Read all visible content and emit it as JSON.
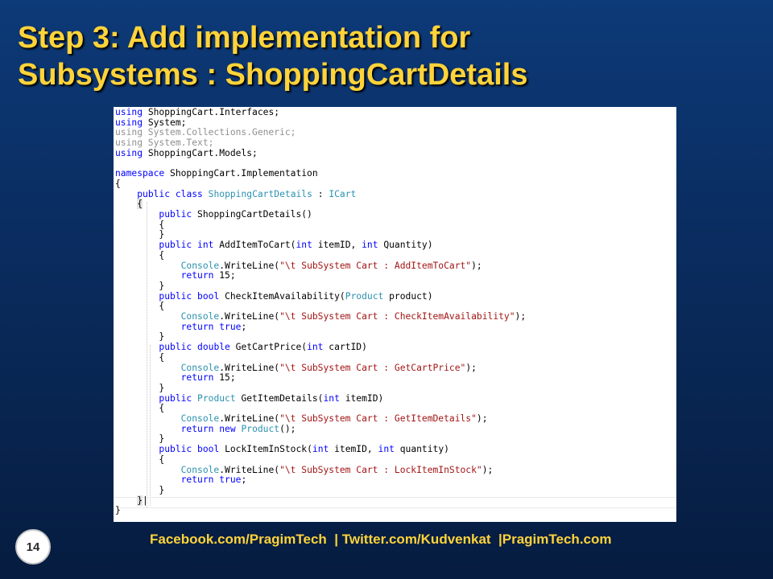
{
  "slide": {
    "title_line1": "Step 3:  Add implementation for",
    "title_line2": "Subsystems : ShoppingCartDetails",
    "page_number": "14",
    "footer": "Facebook.com/PragimTech  | Twitter.com/Kudvenkat  |PragimTech.com"
  },
  "colors": {
    "title": "#ffd33a",
    "keyword": "#0000ff",
    "type": "#2b91af",
    "string": "#a31515",
    "unused_using": "#8f8f8f"
  },
  "code": {
    "lines": [
      [
        {
          "t": "using",
          "c": "kw"
        },
        {
          "t": " ShoppingCart.Interfaces;"
        }
      ],
      [
        {
          "t": "using",
          "c": "kw"
        },
        {
          "t": " System;"
        }
      ],
      [
        {
          "t": "using System.Collections.Generic;",
          "c": "dim"
        }
      ],
      [
        {
          "t": "using System.Text;",
          "c": "dim"
        }
      ],
      [
        {
          "t": "using",
          "c": "kw"
        },
        {
          "t": " ShoppingCart.Models;"
        }
      ],
      [],
      [
        {
          "t": "namespace",
          "c": "kw"
        },
        {
          "t": " ShoppingCart.Implementation"
        }
      ],
      [
        {
          "t": "{"
        }
      ],
      [
        {
          "t": "    "
        },
        {
          "t": "public",
          "c": "kw"
        },
        {
          "t": " "
        },
        {
          "t": "class",
          "c": "kw"
        },
        {
          "t": " "
        },
        {
          "t": "ShoppingCartDetails",
          "c": "ty"
        },
        {
          "t": " : "
        },
        {
          "t": "ICart",
          "c": "ty"
        }
      ],
      [
        {
          "t": "    "
        },
        {
          "t": "{",
          "c": "hl"
        }
      ],
      [
        {
          "t": "        "
        },
        {
          "t": "public",
          "c": "kw"
        },
        {
          "t": " ShoppingCartDetails()"
        }
      ],
      [
        {
          "t": "        {"
        }
      ],
      [
        {
          "t": "        }"
        }
      ],
      [
        {
          "t": "        "
        },
        {
          "t": "public",
          "c": "kw"
        },
        {
          "t": " "
        },
        {
          "t": "int",
          "c": "kw"
        },
        {
          "t": " AddItemToCart("
        },
        {
          "t": "int",
          "c": "kw"
        },
        {
          "t": " itemID, "
        },
        {
          "t": "int",
          "c": "kw"
        },
        {
          "t": " Quantity)"
        }
      ],
      [
        {
          "t": "        {"
        }
      ],
      [
        {
          "t": "            "
        },
        {
          "t": "Console",
          "c": "ty"
        },
        {
          "t": ".WriteLine("
        },
        {
          "t": "\"\\t SubSystem Cart : AddItemToCart\"",
          "c": "st"
        },
        {
          "t": ");"
        }
      ],
      [
        {
          "t": "            "
        },
        {
          "t": "return",
          "c": "kw"
        },
        {
          "t": " 15;"
        }
      ],
      [
        {
          "t": "        }"
        }
      ],
      [
        {
          "t": "        "
        },
        {
          "t": "public",
          "c": "kw"
        },
        {
          "t": " "
        },
        {
          "t": "bool",
          "c": "kw"
        },
        {
          "t": " CheckItemAvailability("
        },
        {
          "t": "Product",
          "c": "ty"
        },
        {
          "t": " product)"
        }
      ],
      [
        {
          "t": "        {"
        }
      ],
      [
        {
          "t": "            "
        },
        {
          "t": "Console",
          "c": "ty"
        },
        {
          "t": ".WriteLine("
        },
        {
          "t": "\"\\t SubSystem Cart : CheckItemAvailability\"",
          "c": "st"
        },
        {
          "t": ");"
        }
      ],
      [
        {
          "t": "            "
        },
        {
          "t": "return",
          "c": "kw"
        },
        {
          "t": " "
        },
        {
          "t": "true",
          "c": "kw"
        },
        {
          "t": ";"
        }
      ],
      [
        {
          "t": "        }"
        }
      ],
      [
        {
          "t": "        "
        },
        {
          "t": "public",
          "c": "kw"
        },
        {
          "t": " "
        },
        {
          "t": "double",
          "c": "kw"
        },
        {
          "t": " GetCartPrice("
        },
        {
          "t": "int",
          "c": "kw"
        },
        {
          "t": " cartID)"
        }
      ],
      [
        {
          "t": "        {"
        }
      ],
      [
        {
          "t": "            "
        },
        {
          "t": "Console",
          "c": "ty"
        },
        {
          "t": ".WriteLine("
        },
        {
          "t": "\"\\t SubSystem Cart : GetCartPrice\"",
          "c": "st"
        },
        {
          "t": ");"
        }
      ],
      [
        {
          "t": "            "
        },
        {
          "t": "return",
          "c": "kw"
        },
        {
          "t": " 15;"
        }
      ],
      [
        {
          "t": "        }"
        }
      ],
      [
        {
          "t": "        "
        },
        {
          "t": "public",
          "c": "kw"
        },
        {
          "t": " "
        },
        {
          "t": "Product",
          "c": "ty"
        },
        {
          "t": " GetItemDetails("
        },
        {
          "t": "int",
          "c": "kw"
        },
        {
          "t": " itemID)"
        }
      ],
      [
        {
          "t": "        {"
        }
      ],
      [
        {
          "t": "            "
        },
        {
          "t": "Console",
          "c": "ty"
        },
        {
          "t": ".WriteLine("
        },
        {
          "t": "\"\\t SubSystem Cart : GetItemDetails\"",
          "c": "st"
        },
        {
          "t": ");"
        }
      ],
      [
        {
          "t": "            "
        },
        {
          "t": "return",
          "c": "kw"
        },
        {
          "t": " "
        },
        {
          "t": "new",
          "c": "kw"
        },
        {
          "t": " "
        },
        {
          "t": "Product",
          "c": "ty"
        },
        {
          "t": "();"
        }
      ],
      [
        {
          "t": "        }"
        }
      ],
      [
        {
          "t": "        "
        },
        {
          "t": "public",
          "c": "kw"
        },
        {
          "t": " "
        },
        {
          "t": "bool",
          "c": "kw"
        },
        {
          "t": " LockItemInStock("
        },
        {
          "t": "int",
          "c": "kw"
        },
        {
          "t": " itemID, "
        },
        {
          "t": "int",
          "c": "kw"
        },
        {
          "t": " quantity)"
        }
      ],
      [
        {
          "t": "        {"
        }
      ],
      [
        {
          "t": "            "
        },
        {
          "t": "Console",
          "c": "ty"
        },
        {
          "t": ".WriteLine("
        },
        {
          "t": "\"\\t SubSystem Cart : LockItemInStock\"",
          "c": "st"
        },
        {
          "t": ");"
        }
      ],
      [
        {
          "t": "            "
        },
        {
          "t": "return",
          "c": "kw"
        },
        {
          "t": " "
        },
        {
          "t": "true",
          "c": "kw"
        },
        {
          "t": ";"
        }
      ],
      [
        {
          "t": "        }"
        }
      ],
      [
        {
          "t": "    "
        },
        {
          "t": "}",
          "c": "hl"
        },
        {
          "t": "|"
        }
      ],
      [
        {
          "t": "}"
        }
      ]
    ]
  }
}
